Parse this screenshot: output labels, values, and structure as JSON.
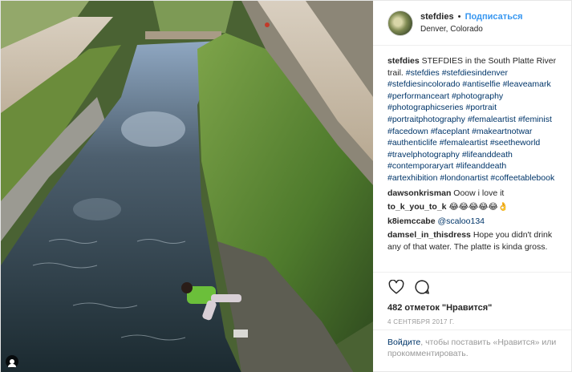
{
  "post": {
    "username": "stefdies",
    "separator": "•",
    "follow_label": "Подписаться",
    "location": "Denver, Colorado"
  },
  "caption": {
    "username": "stefdies",
    "text": "STEFDIES in the South Platte River trail.",
    "hashtags": "#stefdies #stefdiesindenver #stefdiesincolorado #antiselfie #leaveamark #performanceart #photography #photographicseries #portrait #portraitphotography #femaleartist #feminist #facedown #faceplant #makeartnotwar #authenticlife #femaleartist #seetheworld #travelphotography #lifeanddeath #contemporaryart #lifeanddeath #artexhibition #londonartist #coffeetablebook"
  },
  "comments": [
    {
      "username": "dawsonkrisman",
      "text": "Ooow i love it"
    },
    {
      "username": "to_k_you_to_k",
      "text": "😂😂😂😂😂👌"
    },
    {
      "username": "k8iemccabe",
      "text": "@scaloo134"
    },
    {
      "username": "damsel_in_thisdress",
      "text": "Hope you didn't drink any of that water. The platte is kinda gross."
    }
  ],
  "actions": {
    "like_icon": "heart-icon",
    "comment_icon": "comment-bubble-icon"
  },
  "likes_text": "482 отметок \"Нравится\"",
  "date_text": "4 СЕНТЯБРЯ 2017 Г.",
  "login_prompt": {
    "login_link": "Войдите",
    "rest": ", чтобы поставить «Нравится» или прокомментировать."
  },
  "colors": {
    "accent": "#3897f0",
    "link": "#003569",
    "muted": "#999999"
  }
}
